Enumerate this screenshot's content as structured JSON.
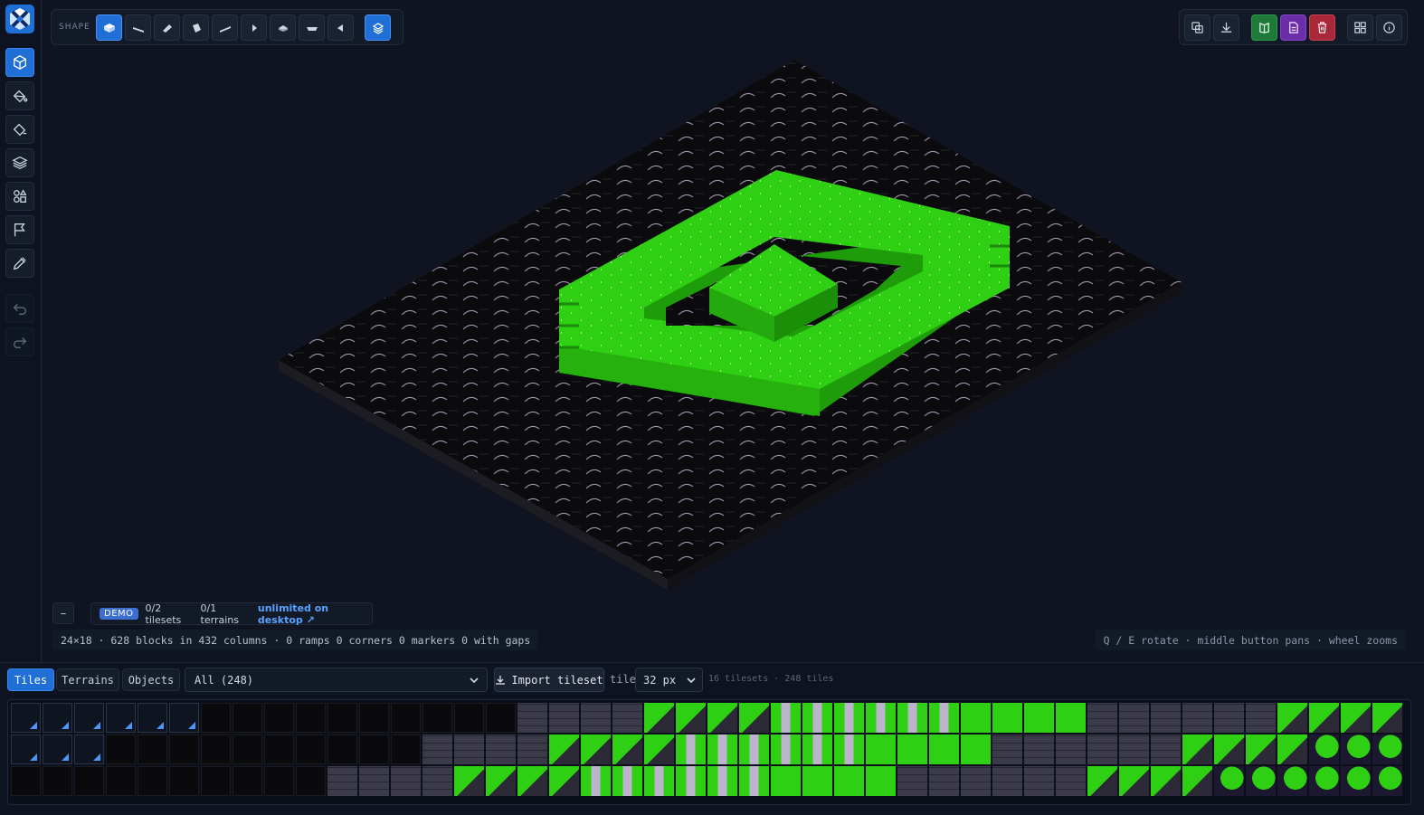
{
  "toolbar": {
    "shape_label": "SHAPE",
    "shapes": [
      "block",
      "slope",
      "wedge",
      "diagonal",
      "thin-slope",
      "corner",
      "half-block",
      "flat-ramp",
      "spike",
      "stack"
    ]
  },
  "right_toolbar": {
    "buttons": [
      "duplicate",
      "download",
      "book",
      "file",
      "delete",
      "grid",
      "info"
    ]
  },
  "demo": {
    "badge": "DEMO",
    "tilesets": "0/2 tilesets",
    "terrains": "0/1 terrains",
    "link": "unlimited on desktop ↗",
    "collapse": "–"
  },
  "status": {
    "line": "24×18 · 628 blocks in 432 columns · 0 ramps 0 corners 0 markers 0 with gaps",
    "hint": "Q / E rotate · middle button pans · wheel zooms"
  },
  "bottom": {
    "tabs": [
      "Tiles",
      "Terrains",
      "Objects"
    ],
    "active_tab": "Tiles",
    "filter_value": "All (248)",
    "import_label": "Import tileset",
    "tile_label": "tile",
    "tile_size": "32 px",
    "counts": "16 tilesets · 248 tiles"
  },
  "colors": {
    "accent": "#1f6fd6",
    "grass": "#2fcf14",
    "ground": "#0b0b0d",
    "background": "#0f1420"
  }
}
